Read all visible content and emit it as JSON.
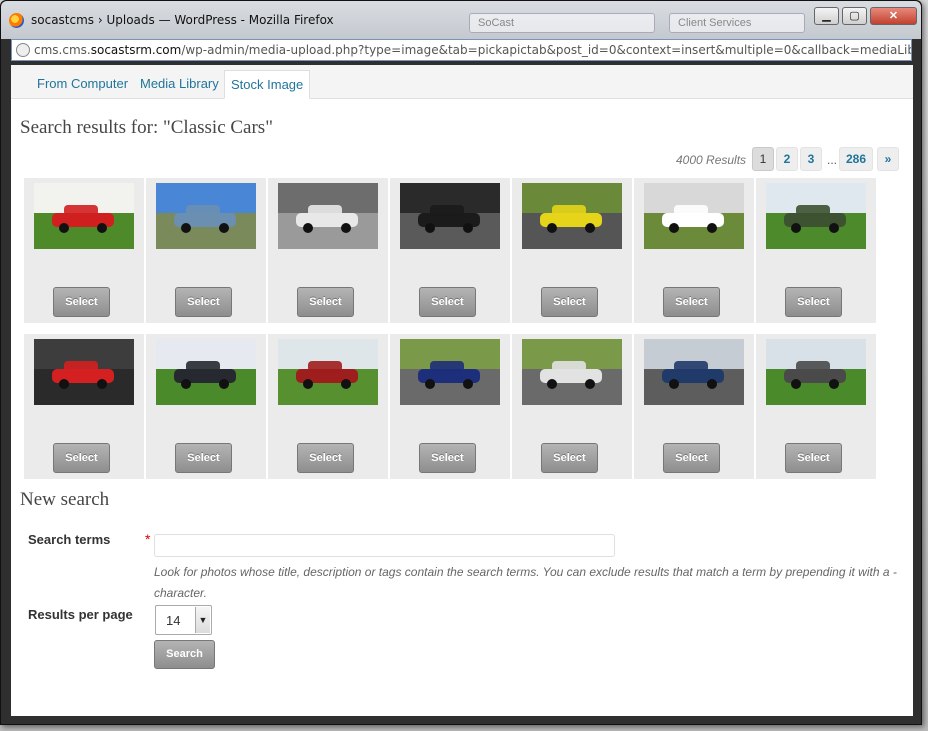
{
  "window": {
    "title": "socastcms › Uploads — WordPress - Mozilla Firefox",
    "minimize": "▁",
    "maximize": "▢",
    "close": "✕",
    "background_field_1": "SoCast",
    "background_field_2": "Client Services"
  },
  "address_bar": {
    "prefix": "cms.cms.",
    "domain": "socastsrm.com",
    "path": "/wp-admin/media-upload.php?type=image&tab=pickapictab&post_id=0&context=insert&multiple=0&callback=mediaLibraryFeatured_ca"
  },
  "tabs": [
    {
      "label": "From Computer",
      "active": false
    },
    {
      "label": "Media Library",
      "active": false
    },
    {
      "label": "Stock Image",
      "active": true
    }
  ],
  "results": {
    "heading": "Search results for: \"Classic Cars\"",
    "count": "4000 Results",
    "pagination": {
      "current": "1",
      "pages": [
        "2",
        "3"
      ],
      "ellipsis": "...",
      "last": "286",
      "next": "»"
    },
    "select_label": "Select",
    "images": [
      {
        "subject": "red-sports-car-on-grass",
        "sky": "#f2f2ee",
        "ground": "#4f8a2a",
        "car": "#d01f1f"
      },
      {
        "subject": "blue-saloon-car",
        "sky": "#4a86d6",
        "ground": "#7b8a5a",
        "car": "#6a8fb0"
      },
      {
        "subject": "white-finned-sedan",
        "sky": "#6d6d6d",
        "ground": "#9a9a9a",
        "car": "#e8e8e8"
      },
      {
        "subject": "black-classic-car-in-garage",
        "sky": "#2a2a2a",
        "ground": "#5a5a5a",
        "car": "#1b1b1b"
      },
      {
        "subject": "yellow-race-car-on-track",
        "sky": "#6a8a3a",
        "ground": "#555555",
        "car": "#e5d41a"
      },
      {
        "subject": "formula-cars-on-track",
        "sky": "#d8d8d8",
        "ground": "#6b8b3b",
        "car": "#ffffff"
      },
      {
        "subject": "green-land-rover",
        "sky": "#dfe8ef",
        "ground": "#4c8a2c",
        "car": "#3c5230"
      },
      {
        "subject": "red-convertible-near-castle",
        "sky": "#3d3d3d",
        "ground": "#2a2a2a",
        "car": "#d42020"
      },
      {
        "subject": "dark-saloon-on-lawn",
        "sky": "#e6eaf0",
        "ground": "#4a8a2a",
        "car": "#262a30"
      },
      {
        "subject": "red-vintage-car",
        "sky": "#dfe6ea",
        "ground": "#57902f",
        "car": "#9e1d1d"
      },
      {
        "subject": "formula-car-racing",
        "sky": "#7a9a4a",
        "ground": "#6a6a6a",
        "car": "#1d2f7a"
      },
      {
        "subject": "white-race-saloon",
        "sky": "#7a9a4a",
        "ground": "#6a6a6a",
        "car": "#e2e2e2"
      },
      {
        "subject": "classic-cars-parked-row",
        "sky": "#c5ccd4",
        "ground": "#5d5d5d",
        "car": "#203a6a"
      },
      {
        "subject": "grey-classic-saloon",
        "sky": "#d8e0e8",
        "ground": "#4a8a2a",
        "car": "#4a4a4a"
      }
    ]
  },
  "new_search": {
    "heading": "New search",
    "search_terms_label": "Search terms",
    "required_mark": "*",
    "search_terms_value": "",
    "help_text": "Look for photos whose title, description or tags contain the search terms. You can exclude results that match a term by prepending it with a - character.",
    "results_per_page_label": "Results per page",
    "results_per_page_value": "14",
    "search_button": "Search"
  }
}
